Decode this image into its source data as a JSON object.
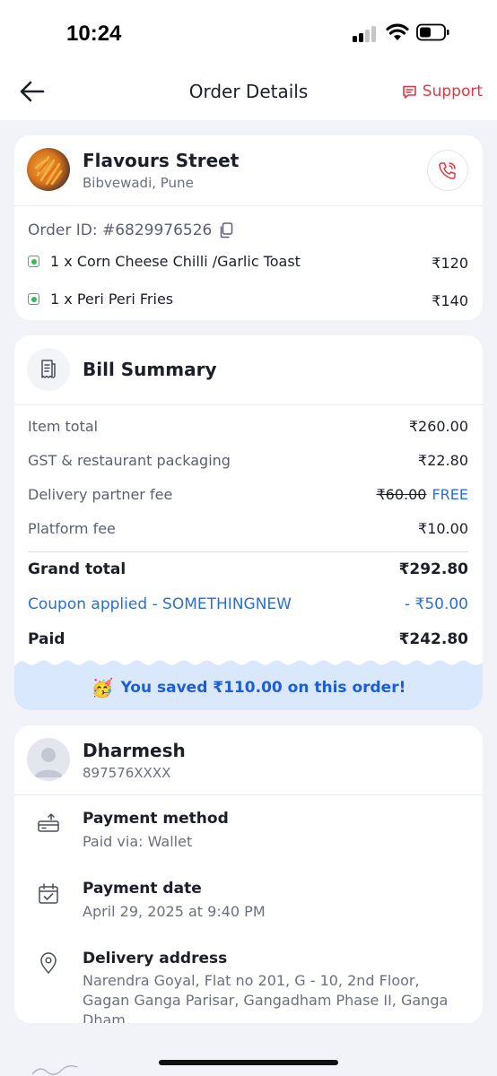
{
  "status_bar": {
    "time": "10:24"
  },
  "nav": {
    "title": "Order Details",
    "support_label": "Support"
  },
  "restaurant": {
    "name": "Flavours Street",
    "location": "Bibvewadi, Pune",
    "order_id": "Order ID: #6829976526",
    "items": [
      {
        "name": "1 x Corn Cheese Chilli /Garlic Toast",
        "price": "₹120"
      },
      {
        "name": "1 x Peri Peri Fries",
        "price": "₹140"
      }
    ]
  },
  "bill": {
    "title": "Bill Summary",
    "item_total_label": "Item total",
    "item_total_value": "₹260.00",
    "gst_label": "GST & restaurant packaging",
    "gst_value": "₹22.80",
    "delivery_label": "Delivery partner fee",
    "delivery_original": "₹60.00",
    "delivery_value": "FREE",
    "platform_label": "Platform fee",
    "platform_value": "₹10.00",
    "grand_total_label": "Grand total",
    "grand_total_value": "₹292.80",
    "coupon_label": "Coupon applied - SOMETHINGNEW",
    "coupon_value": "- ₹50.00",
    "paid_label": "Paid",
    "paid_value": "₹242.80",
    "savings_text": "You saved ₹110.00 on this order!"
  },
  "customer": {
    "name": "Dharmesh",
    "phone": "897576XXXX",
    "payment_method_title": "Payment method",
    "payment_method_value": "Paid via: Wallet",
    "payment_date_title": "Payment date",
    "payment_date_value": "April 29, 2025 at 9:40 PM",
    "address_title": "Delivery address",
    "address_value": "Narendra Goyal, Flat no 201, G - 10, 2nd Floor, Gagan Ganga Parisar, Gangadham Phase II, Ganga Dham"
  },
  "colors": {
    "accent_red": "#e23744",
    "accent_blue": "#2a6fd6",
    "veg_green": "#3ab757",
    "savings_bg": "#dae8fd"
  },
  "icons": [
    "back-arrow-icon",
    "support-chat-icon",
    "phone-call-icon",
    "copy-icon",
    "receipt-icon",
    "party-emoji-icon",
    "user-avatar-icon",
    "wallet-icon",
    "calendar-icon",
    "location-pin-icon"
  ]
}
